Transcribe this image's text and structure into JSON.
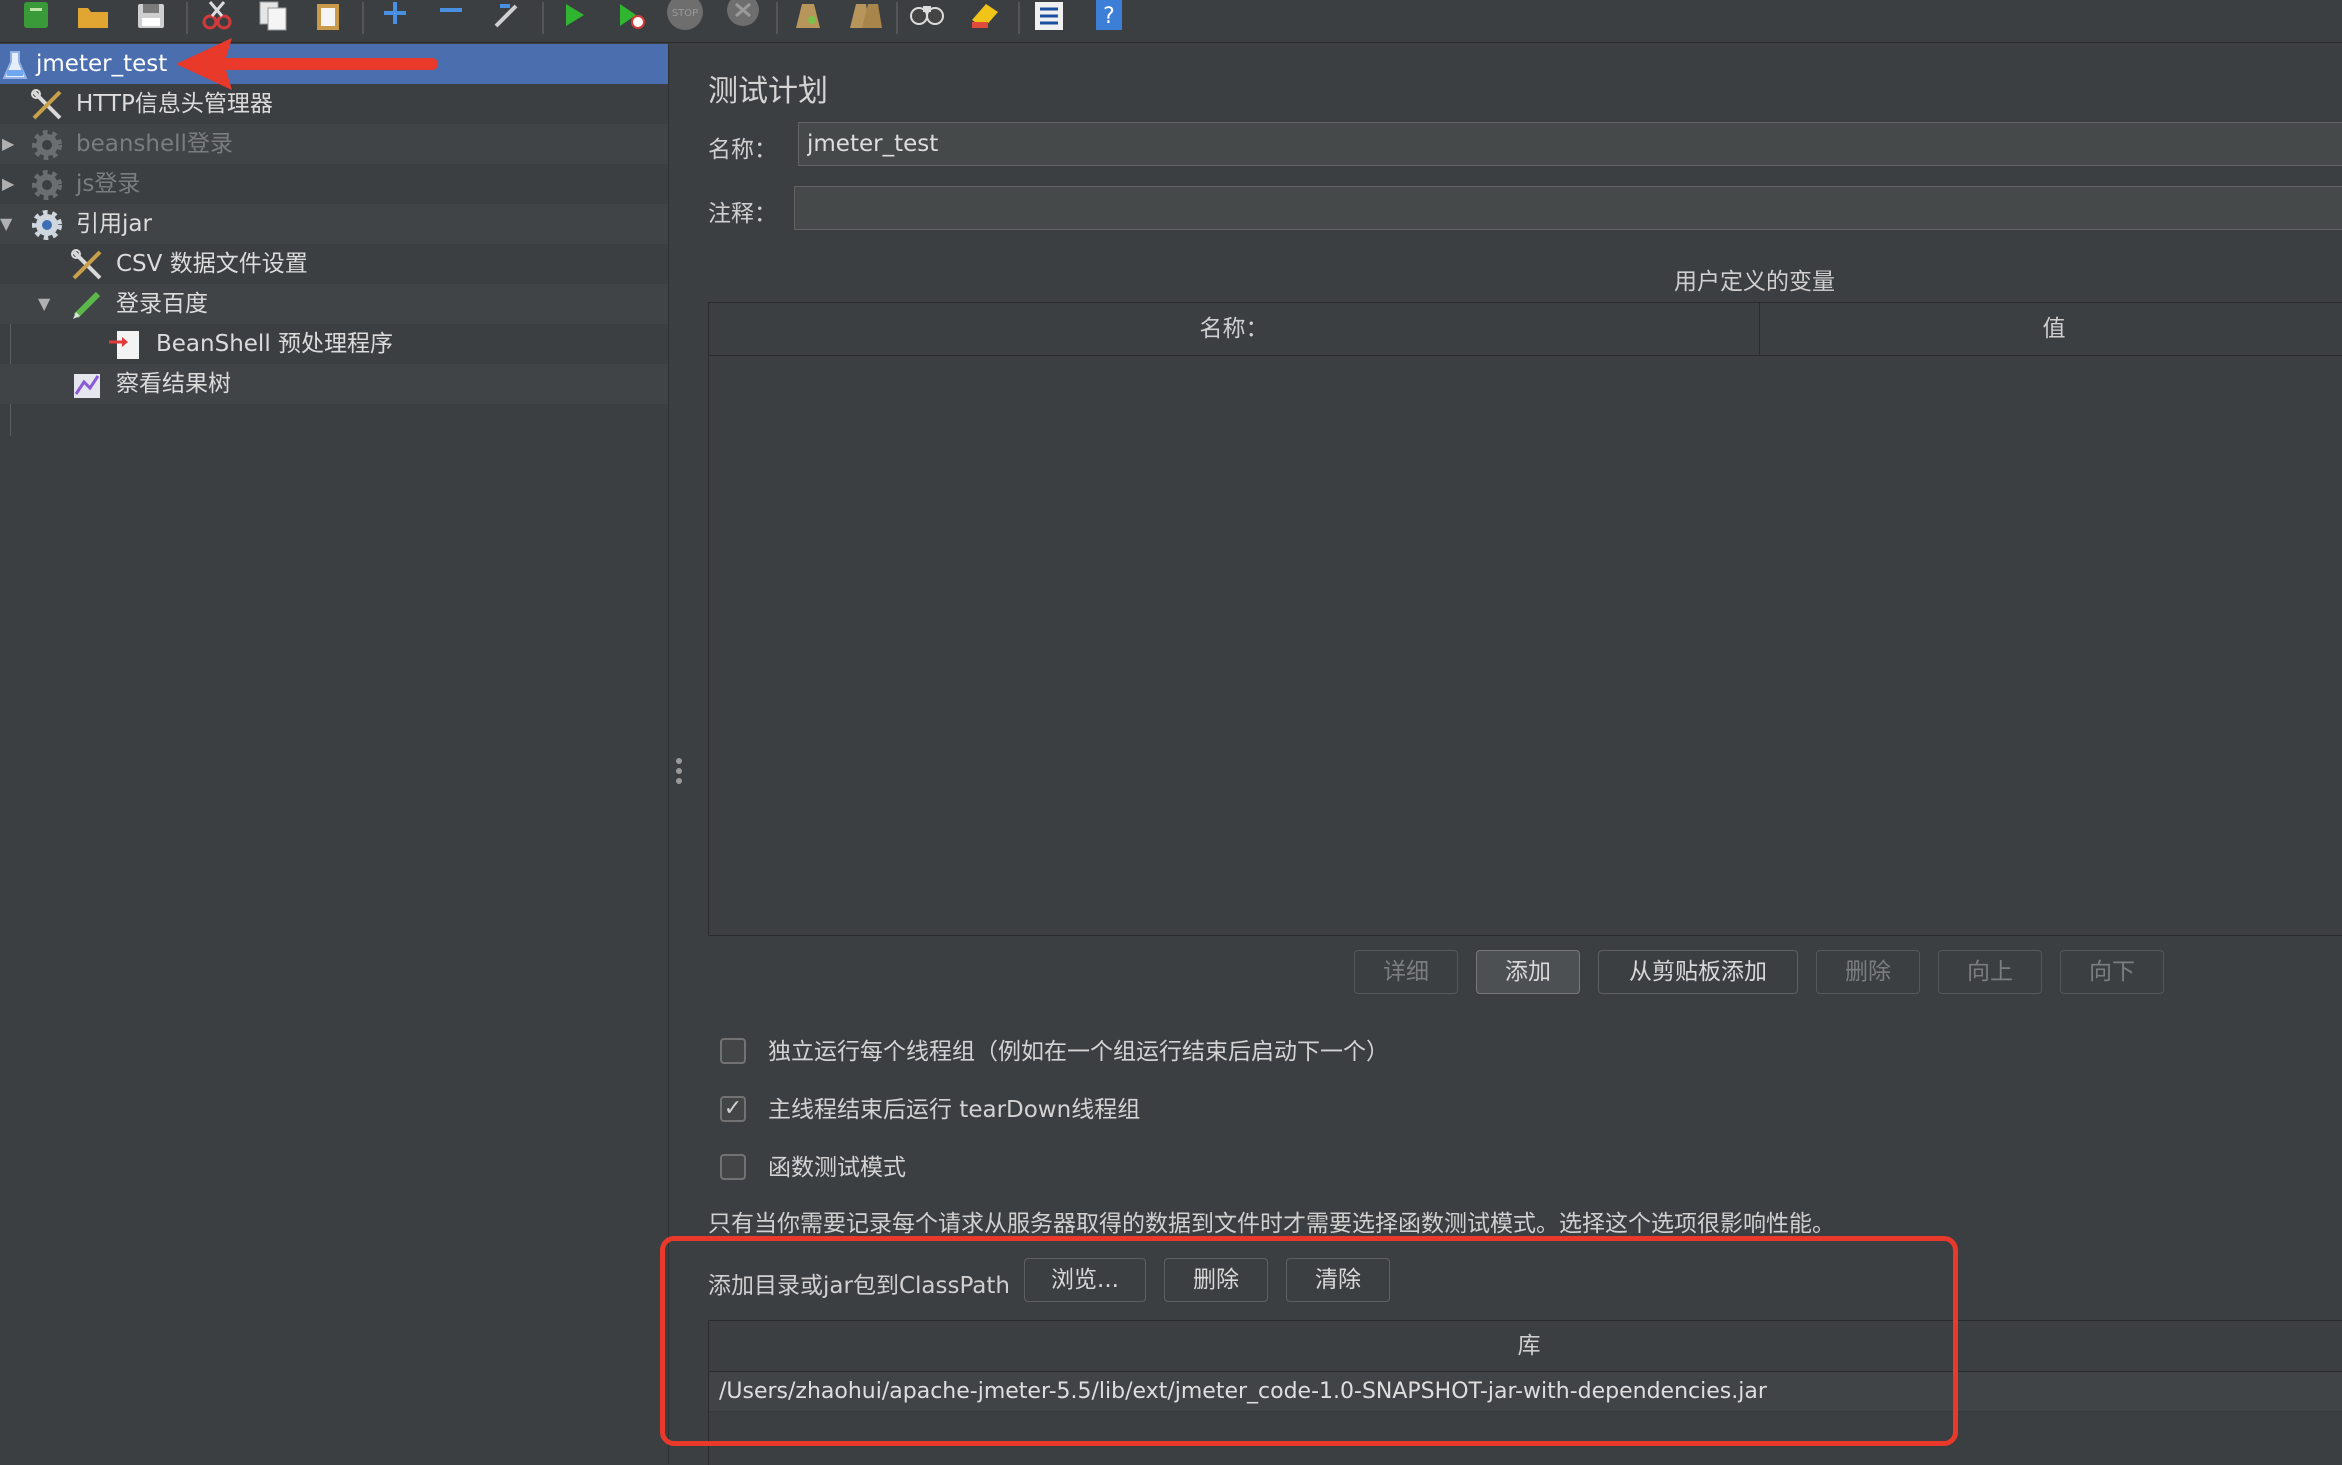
{
  "toolbar": {
    "icons": [
      "new-icon",
      "templates-icon",
      "open-icon",
      "save-icon",
      "cut-icon",
      "copy-icon",
      "paste-icon",
      "expand-icon",
      "collapse-icon",
      "toggle-icon",
      "start-icon",
      "start-no-pauses-icon",
      "stop-icon",
      "shutdown-icon",
      "clear-icon",
      "clear-all-icon",
      "search-icon",
      "reset-search-icon",
      "function-helper-icon",
      "help-icon"
    ],
    "stop_label": "STOP"
  },
  "tree": {
    "items": [
      {
        "label": "jmeter_test",
        "icon": "test-plan-icon",
        "selected": true
      },
      {
        "label": "HTTP信息头管理器",
        "icon": "config-tools-icon"
      },
      {
        "label": "beanshell登录",
        "icon": "thread-group-gear-icon",
        "disabled": true
      },
      {
        "label": "js登录",
        "icon": "thread-group-gear-icon",
        "disabled": true
      },
      {
        "label": "引用jar",
        "icon": "thread-group-gear-icon"
      },
      {
        "label": "CSV 数据文件设置",
        "icon": "config-tools-icon"
      },
      {
        "label": "登录百度",
        "icon": "sampler-pen-icon"
      },
      {
        "label": "BeanShell 预处理程序",
        "icon": "preprocessor-icon"
      },
      {
        "label": "察看结果树",
        "icon": "listener-graph-icon"
      }
    ]
  },
  "panel": {
    "title": "测试计划",
    "name_label": "名称：",
    "name_value": "jmeter_test",
    "comment_label": "注释：",
    "comment_value": "",
    "udv_title": "用户定义的变量",
    "udv_columns": [
      "名称：",
      "值"
    ],
    "udv_buttons": [
      {
        "label": "详细",
        "enabled": false
      },
      {
        "label": "添加",
        "enabled": true
      },
      {
        "label": "从剪贴板添加",
        "enabled": true
      },
      {
        "label": "删除",
        "enabled": false
      },
      {
        "label": "向上",
        "enabled": false
      },
      {
        "label": "向下",
        "enabled": false
      }
    ],
    "options": [
      {
        "label": "独立运行每个线程组（例如在一个组运行结束后启动下一个）",
        "checked": false
      },
      {
        "label": "主线程结束后运行 tearDown线程组",
        "checked": true
      },
      {
        "label": "函数测试模式",
        "checked": false
      }
    ],
    "functional_hint": "只有当你需要记录每个请求从服务器取得的数据到文件时才需要选择函数测试模式。选择这个选项很影响性能。",
    "classpath_label": "添加目录或jar包到ClassPath",
    "classpath_buttons": [
      "浏览...",
      "删除",
      "清除"
    ],
    "library_header": "库",
    "library_rows": [
      "/Users/zhaohui/apache-jmeter-5.5/lib/ext/jmeter_code-1.0-SNAPSHOT-jar-with-dependencies.jar"
    ]
  },
  "colors": {
    "selection": "#4b6eaf",
    "annotation": "#e8392b",
    "background": "#3c3f41"
  }
}
